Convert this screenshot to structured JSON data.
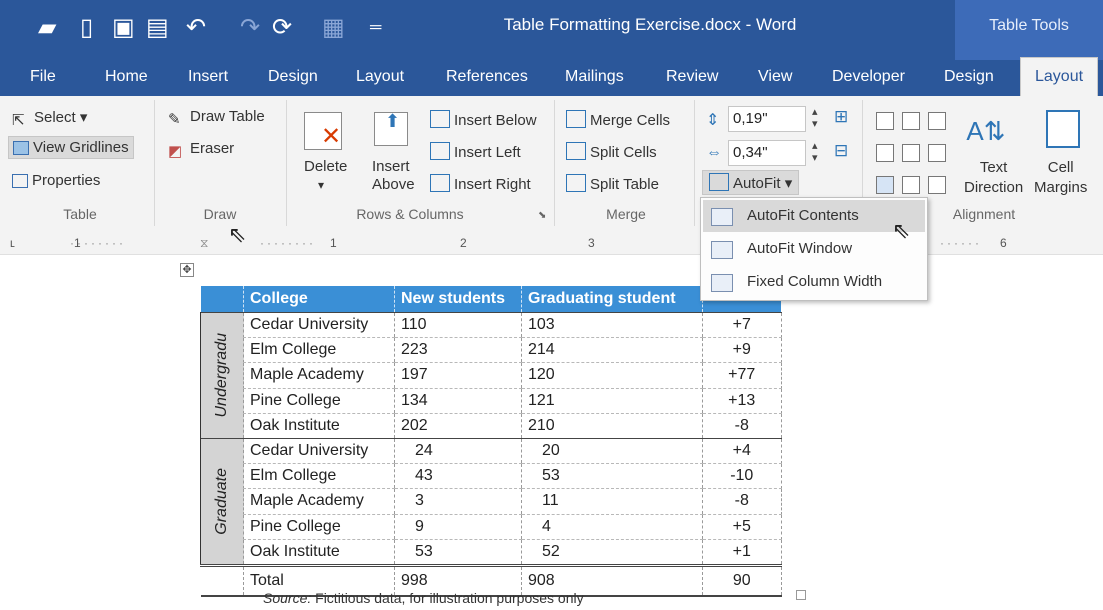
{
  "window": {
    "title": "Table Formatting Exercise.docx - Word",
    "context_title": "Table Tools"
  },
  "tabs": [
    "File",
    "Home",
    "Insert",
    "Design",
    "Layout",
    "References",
    "Mailings",
    "Review",
    "View",
    "Developer",
    "Design",
    "Layout"
  ],
  "active_tab": "Layout",
  "ribbon": {
    "table": {
      "select": "Select",
      "view_gridlines": "View Gridlines",
      "properties": "Properties",
      "group": "Table"
    },
    "draw": {
      "draw_table": "Draw Table",
      "eraser": "Eraser",
      "group": "Draw"
    },
    "rows_columns": {
      "delete": "Delete",
      "insert_above_1": "Insert",
      "insert_above_2": "Above",
      "insert_below": "Insert Below",
      "insert_left": "Insert Left",
      "insert_right": "Insert Right",
      "group": "Rows & Columns"
    },
    "merge": {
      "merge_cells": "Merge Cells",
      "split_cells": "Split Cells",
      "split_table": "Split Table",
      "group": "Merge"
    },
    "cell_size": {
      "height": "0,19\"",
      "width": "0,34\"",
      "autofit": "AutoFit"
    },
    "alignment": {
      "text_direction_1": "Text",
      "text_direction_2": "Direction",
      "cell_margins_1": "Cell",
      "cell_margins_2": "Margins",
      "group": "Alignment"
    }
  },
  "ruler": {
    "marks": [
      "1",
      "1",
      "2",
      "3",
      "6"
    ]
  },
  "autofit_menu": {
    "items": [
      "AutoFit Contents",
      "AutoFit Window",
      "Fixed Column Width"
    ],
    "selected": "AutoFit Contents"
  },
  "table": {
    "headers": [
      "College",
      "New students",
      "Graduating student"
    ],
    "groups": [
      {
        "label": "Undergradu",
        "rows": [
          {
            "college": "Cedar University",
            "new": "110",
            "grad": "103",
            "diff": "+7"
          },
          {
            "college": "Elm College",
            "new": "223",
            "grad": "214",
            "diff": "+9"
          },
          {
            "college": "Maple Academy",
            "new": "197",
            "grad": "120",
            "diff": "+77"
          },
          {
            "college": "Pine College",
            "new": "134",
            "grad": "121",
            "diff": "+13"
          },
          {
            "college": "Oak Institute",
            "new": "202",
            "grad": "210",
            "diff": "-8"
          }
        ]
      },
      {
        "label": "Graduate",
        "rows": [
          {
            "college": "Cedar University",
            "new": "24",
            "grad": "20",
            "diff": "+4"
          },
          {
            "college": "Elm College",
            "new": "43",
            "grad": "53",
            "diff": "-10"
          },
          {
            "college": "Maple Academy",
            "new": "3",
            "grad": "11",
            "diff": "-8"
          },
          {
            "college": "Pine College",
            "new": "9",
            "grad": "4",
            "diff": "+5"
          },
          {
            "college": "Oak Institute",
            "new": "53",
            "grad": "52",
            "diff": "+1"
          }
        ]
      }
    ],
    "total": {
      "label": "Total",
      "new": "998",
      "grad": "908",
      "diff": "90"
    }
  },
  "source": {
    "label": "Source:",
    "text": " Fictitious data, for illustration purposes only"
  },
  "colors": {
    "title_bar": "#2b579a",
    "table_header": "#3a8fd6"
  }
}
